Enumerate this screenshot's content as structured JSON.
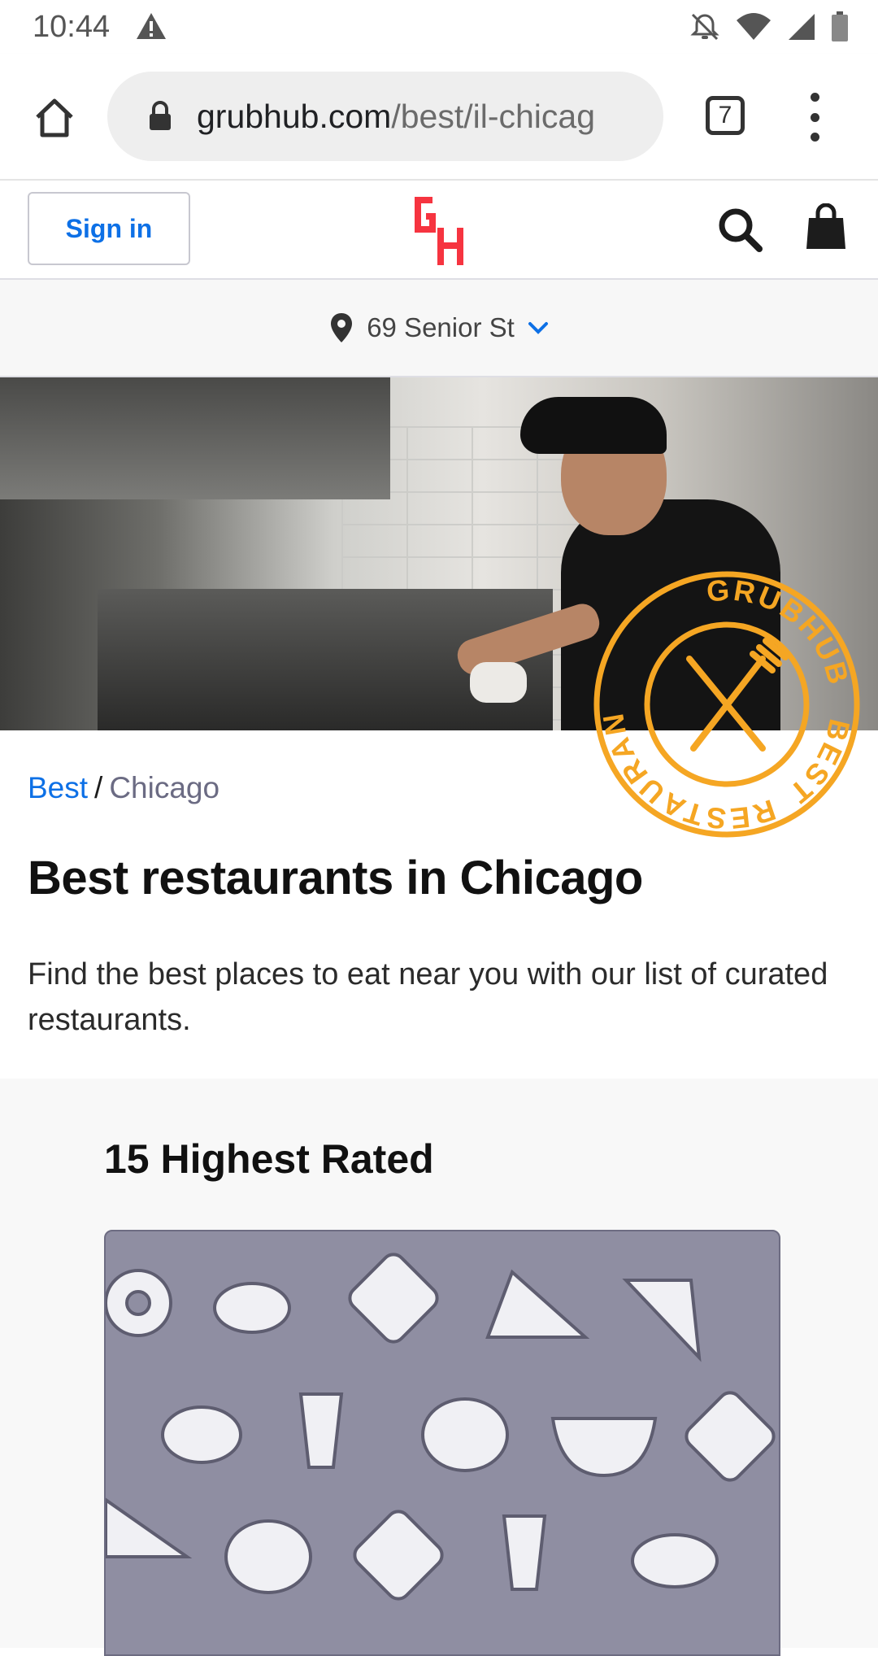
{
  "status_bar": {
    "time": "10:44",
    "icons": [
      "alert-icon",
      "notifications-off-icon",
      "wifi-icon",
      "signal-icon",
      "battery-icon"
    ]
  },
  "browser": {
    "url_domain": "grubhub.com",
    "url_path": "/best/il-chicag",
    "tab_count": "7"
  },
  "header": {
    "sign_in_label": "Sign in",
    "logo_text": "GH",
    "brand_color": "#f63440",
    "link_color": "#0d70e6"
  },
  "address": {
    "label": "69 Senior St"
  },
  "badge": {
    "top_text": "GRUBHUB",
    "side_text": "BEST",
    "bottom_text": "RESTAURANTS",
    "color": "#f5a623"
  },
  "breadcrumb": {
    "parent": "Best",
    "separator": "/",
    "current": "Chicago"
  },
  "page": {
    "title": "Best restaurants in Chicago",
    "description": "Find the best places to eat near you with our list of curated restaurants."
  },
  "rated": {
    "title": "15 Highest Rated"
  }
}
